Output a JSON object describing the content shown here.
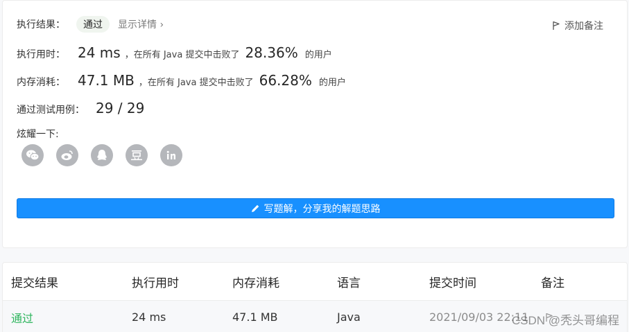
{
  "result": {
    "label": "执行结果：",
    "status": "通过",
    "details_link": "显示详情 ›",
    "add_note": "添加备注"
  },
  "runtime": {
    "label": "执行用时：",
    "value": "24 ms",
    "mid": "，在所有 Java 提交中击败了",
    "percent": "28.36%",
    "suffix": "的用户"
  },
  "memory": {
    "label": "内存消耗：",
    "value": "47.1 MB",
    "mid": "，在所有 Java 提交中击败了",
    "percent": "66.28%",
    "suffix": "的用户"
  },
  "tests": {
    "label": "通过测试用例：",
    "value": "29 / 29"
  },
  "share": {
    "label": "炫耀一下:",
    "icons": [
      "wechat-icon",
      "weibo-icon",
      "qq-icon",
      "douban-icon",
      "linkedin-icon"
    ]
  },
  "write_button": "写题解，分享我的解题思路",
  "table": {
    "headers": [
      "提交结果",
      "执行用时",
      "内存消耗",
      "语言",
      "提交时间",
      "备注"
    ],
    "rows": [
      {
        "result": "通过",
        "runtime": "24 ms",
        "memory": "47.1 MB",
        "language": "Java",
        "time": "2021/09/03 22:11"
      }
    ]
  },
  "watermark": "CSDN @秃头哥编程",
  "colors": {
    "accent": "#1890ff",
    "pass": "#2db55d",
    "icon_gray": "#b5b7bb"
  }
}
